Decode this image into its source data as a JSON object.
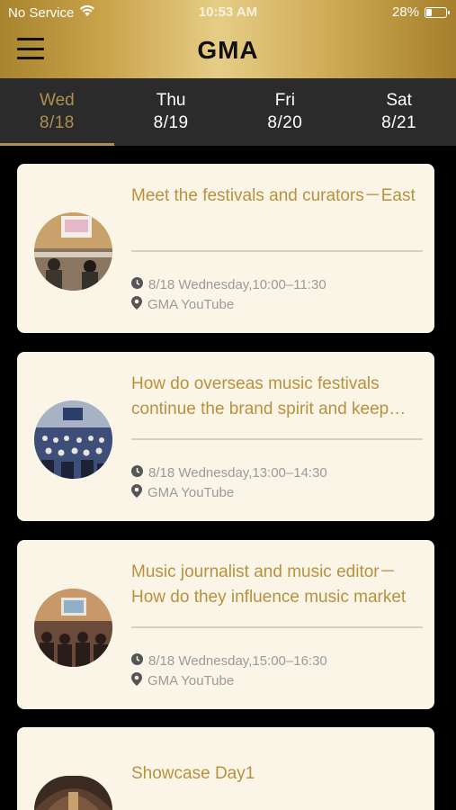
{
  "status_bar": {
    "carrier": "No Service",
    "time": "10:53 AM",
    "battery": "28%",
    "battery_level": 0.28
  },
  "nav": {
    "logo": "GMA"
  },
  "tabs": [
    {
      "day": "Wed",
      "date": "8/18",
      "active": true
    },
    {
      "day": "Thu",
      "date": "8/19",
      "active": false
    },
    {
      "day": "Fri",
      "date": "8/20",
      "active": false
    },
    {
      "day": "Sat",
      "date": "8/21",
      "active": false
    }
  ],
  "events": [
    {
      "title": "Meet the festivals and curators－East",
      "datetime": "8/18 Wednesday,10:00–11:30",
      "location": "GMA YouTube"
    },
    {
      "title": "How do overseas music festivals continue the brand spirit and keep their momentum",
      "datetime": "8/18 Wednesday,13:00–14:30",
      "location": "GMA YouTube"
    },
    {
      "title": "Music journalist and music editor－How do they influence music market",
      "datetime": "8/18 Wednesday,15:00–16:30",
      "location": "GMA YouTube"
    },
    {
      "title": "Showcase Day1",
      "datetime": "",
      "location": ""
    }
  ],
  "colors": {
    "accent_gold": "#b8913d",
    "tab_bg": "#2b2b2b",
    "card_bg": "#fbf5e8"
  }
}
